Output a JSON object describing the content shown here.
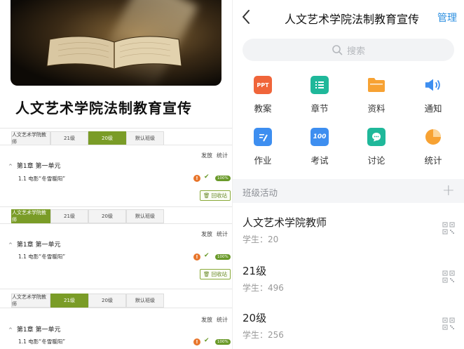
{
  "left": {
    "title": "人文艺术学院法制教育宣传",
    "sections": [
      {
        "tabs": [
          "人文艺术学院教师",
          "21级",
          "20级",
          "默认班级"
        ],
        "active_tab": 2,
        "actions": [
          "发放",
          "统计"
        ],
        "chapter": "第1章 第一单元",
        "lesson": "1.1  电影“冬雪暖阳”",
        "badge": "!",
        "percent": "100%",
        "recycle": "回收站"
      },
      {
        "tabs": [
          "人文艺术学院教师",
          "21级",
          "20级",
          "默认班级"
        ],
        "active_tab": 0,
        "actions": [
          "发放",
          "统计"
        ],
        "chapter": "第1章 第一单元",
        "lesson": "1.1  电影“冬雪暖阳”",
        "badge": "!",
        "percent": "100%",
        "recycle": "回收站"
      },
      {
        "tabs": [
          "人文艺术学院教师",
          "21级",
          "20级",
          "默认班级"
        ],
        "active_tab": 1,
        "actions": [
          "发放",
          "统计"
        ],
        "chapter": "第1章 第一单元",
        "lesson": "1.1  电影“冬雪暖阳”",
        "badge": "!",
        "percent": "100%"
      }
    ],
    "accent_color": "#7a9c27"
  },
  "right": {
    "title": "人文艺术学院法制教育宣传",
    "manage": "管理",
    "search_placeholder": "搜索",
    "grid": [
      {
        "label": "教案",
        "icon": "ppt-icon",
        "icon_text": "PPT",
        "color": "#f0653a"
      },
      {
        "label": "章节",
        "icon": "chapter-list-icon",
        "color": "#1fb89a"
      },
      {
        "label": "资料",
        "icon": "folder-icon",
        "color": "#f7a233"
      },
      {
        "label": "通知",
        "icon": "speaker-icon",
        "color": "#3d8ef0"
      },
      {
        "label": "作业",
        "icon": "homework-icon",
        "color": "#3d8ef0"
      },
      {
        "label": "考试",
        "icon": "exam-icon",
        "icon_text": "100",
        "color": "#3d8ef0"
      },
      {
        "label": "讨论",
        "icon": "discussion-icon",
        "color": "#1fb89a"
      },
      {
        "label": "统计",
        "icon": "pie-chart-icon",
        "color": "#f7a233"
      }
    ],
    "band_title": "班级活动",
    "classes": [
      {
        "name": "人文艺术学院教师",
        "students": "学生：20"
      },
      {
        "name": "21级",
        "students": "学生：496"
      },
      {
        "name": "20级",
        "students": "学生：256"
      }
    ],
    "link_color": "#2c8fe0"
  }
}
